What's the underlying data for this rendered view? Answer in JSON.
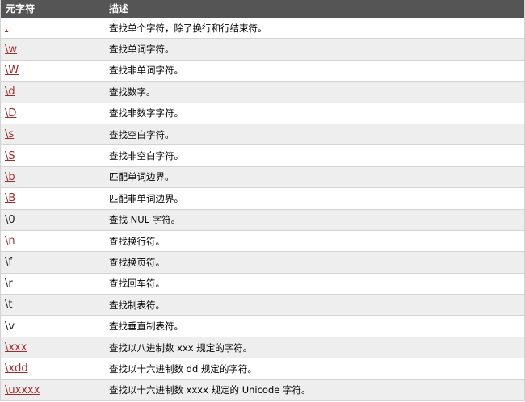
{
  "header": {
    "col1": "元字符",
    "col2": "描述"
  },
  "rows": [
    {
      "meta": ".",
      "desc": "查找单个字符，除了换行和行结束符。",
      "link": true
    },
    {
      "meta": "\\w",
      "desc": "查找单词字符。",
      "link": true
    },
    {
      "meta": "\\W",
      "desc": "查找非单词字符。",
      "link": true
    },
    {
      "meta": "\\d",
      "desc": "查找数字。",
      "link": true
    },
    {
      "meta": "\\D",
      "desc": "查找非数字字符。",
      "link": true
    },
    {
      "meta": "\\s",
      "desc": "查找空白字符。",
      "link": true
    },
    {
      "meta": "\\S",
      "desc": "查找非空白字符。",
      "link": true
    },
    {
      "meta": "\\b",
      "desc": "匹配单词边界。",
      "link": true
    },
    {
      "meta": "\\B",
      "desc": "匹配非单词边界。",
      "link": true
    },
    {
      "meta": "\\0",
      "desc": "查找 NUL 字符。",
      "link": false
    },
    {
      "meta": "\\n",
      "desc": "查找换行符。",
      "link": true
    },
    {
      "meta": "\\f",
      "desc": "查找换页符。",
      "link": false
    },
    {
      "meta": "\\r",
      "desc": "查找回车符。",
      "link": false
    },
    {
      "meta": "\\t",
      "desc": "查找制表符。",
      "link": false
    },
    {
      "meta": "\\v",
      "desc": "查找垂直制表符。",
      "link": false
    },
    {
      "meta": "\\xxx",
      "desc": "查找以八进制数 xxx 规定的字符。",
      "link": true
    },
    {
      "meta": "\\xdd",
      "desc": "查找以十六进制数 dd 规定的字符。",
      "link": true
    },
    {
      "meta": "\\uxxxx",
      "desc": "查找以十六进制数 xxxx 规定的 Unicode 字符。",
      "link": true
    }
  ],
  "colors": {
    "header_bg": "#555555",
    "link": "#a52a2a",
    "row_alt": "#eeeeee"
  }
}
